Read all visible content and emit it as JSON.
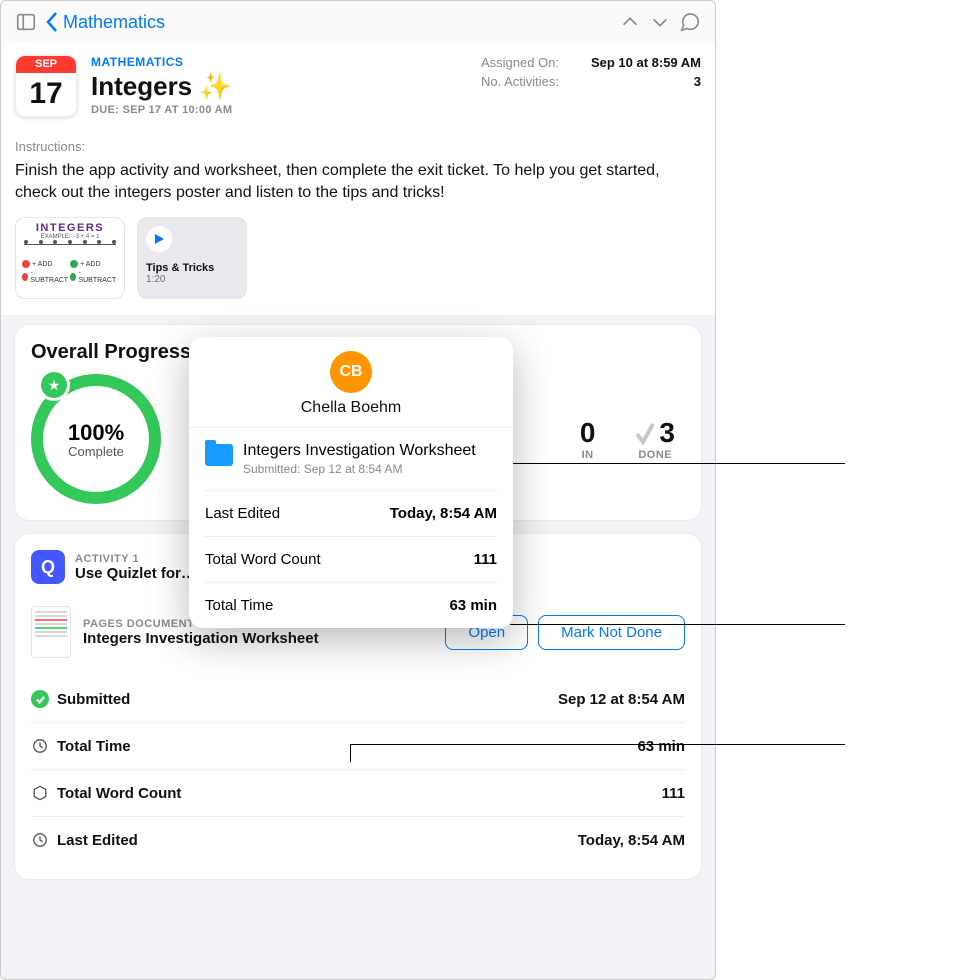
{
  "nav": {
    "back_label": "Mathematics"
  },
  "header": {
    "calendar": {
      "month": "SEP",
      "day": "17"
    },
    "eyebrow": "MATHEMATICS",
    "title": "Integers ✨",
    "due": "DUE: SEP 17 AT 10:00 AM",
    "meta": {
      "assigned_label": "Assigned On:",
      "assigned_value": "Sep 10 at 8:59 AM",
      "activities_label": "No. Activities:",
      "activities_value": "3"
    },
    "instructions_label": "Instructions:",
    "instructions": "Finish the app activity and worksheet, then complete the exit ticket. To help you get started, check out the integers poster and listen to the tips and tricks!",
    "attachments": {
      "poster_title": "INTEGERS",
      "media_title": "Tips & Tricks",
      "media_duration": "1:20"
    }
  },
  "progress": {
    "heading": "Overall Progress",
    "percent": "100%",
    "complete_label": "Complete",
    "done_count": "3",
    "done_label": "DONE",
    "other_count": "0"
  },
  "activity": {
    "eyebrow": "ACTIVITY 1",
    "title": "Use Quizlet for…",
    "doc_eyebrow": "PAGES DOCUMENT",
    "doc_title": "Integers Investigation Worksheet",
    "open_label": "Open",
    "mark_label": "Mark Not Done",
    "submitted_label": "Submitted",
    "submitted_value": "Sep 12 at 8:54 AM",
    "total_time_label": "Total Time",
    "total_time_value": "63 min",
    "word_count_label": "Total Word Count",
    "word_count_value": "111",
    "last_edited_label": "Last Edited",
    "last_edited_value": "Today, 8:54 AM"
  },
  "popover": {
    "initials": "CB",
    "name": "Chella Boehm",
    "file_title": "Integers Investigation Worksheet",
    "file_sub": "Submitted: Sep 12 at 8:54 AM",
    "last_edited_label": "Last Edited",
    "last_edited_value": "Today, 8:54 AM",
    "word_count_label": "Total Word Count",
    "word_count_value": "111",
    "total_time_label": "Total Time",
    "total_time_value": "63 min"
  }
}
